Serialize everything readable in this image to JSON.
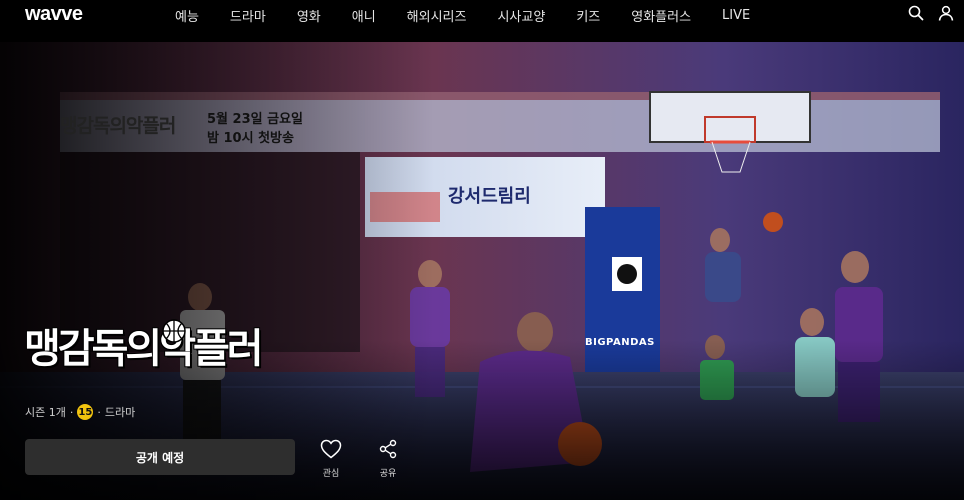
{
  "header": {
    "logo": "wavve",
    "nav": [
      "예능",
      "드라마",
      "영화",
      "애니",
      "해외시리즈",
      "시사교양",
      "키즈",
      "영화플러스",
      "LIVE"
    ],
    "icons": [
      "search-icon",
      "user-icon"
    ]
  },
  "hero": {
    "promo_logo": "맹감독의악플러",
    "promo_date": "5월 23일 금요일",
    "promo_time": "밤 10시 첫방송",
    "banner_text": "강서드림리",
    "panda_sign": "BIGPANDAS",
    "title": "맹감독의악플러",
    "meta": {
      "season": "시즌 1개",
      "separator": "·",
      "rating": "15",
      "genre": "드라마"
    },
    "cta_label": "공개 예정",
    "actions": {
      "like_label": "관심",
      "share_label": "공유"
    }
  },
  "colors": {
    "background": "#000000",
    "button": "#2e2e2e",
    "rating_badge": "#f2c40f",
    "court_purple": "#5b2a8c"
  }
}
